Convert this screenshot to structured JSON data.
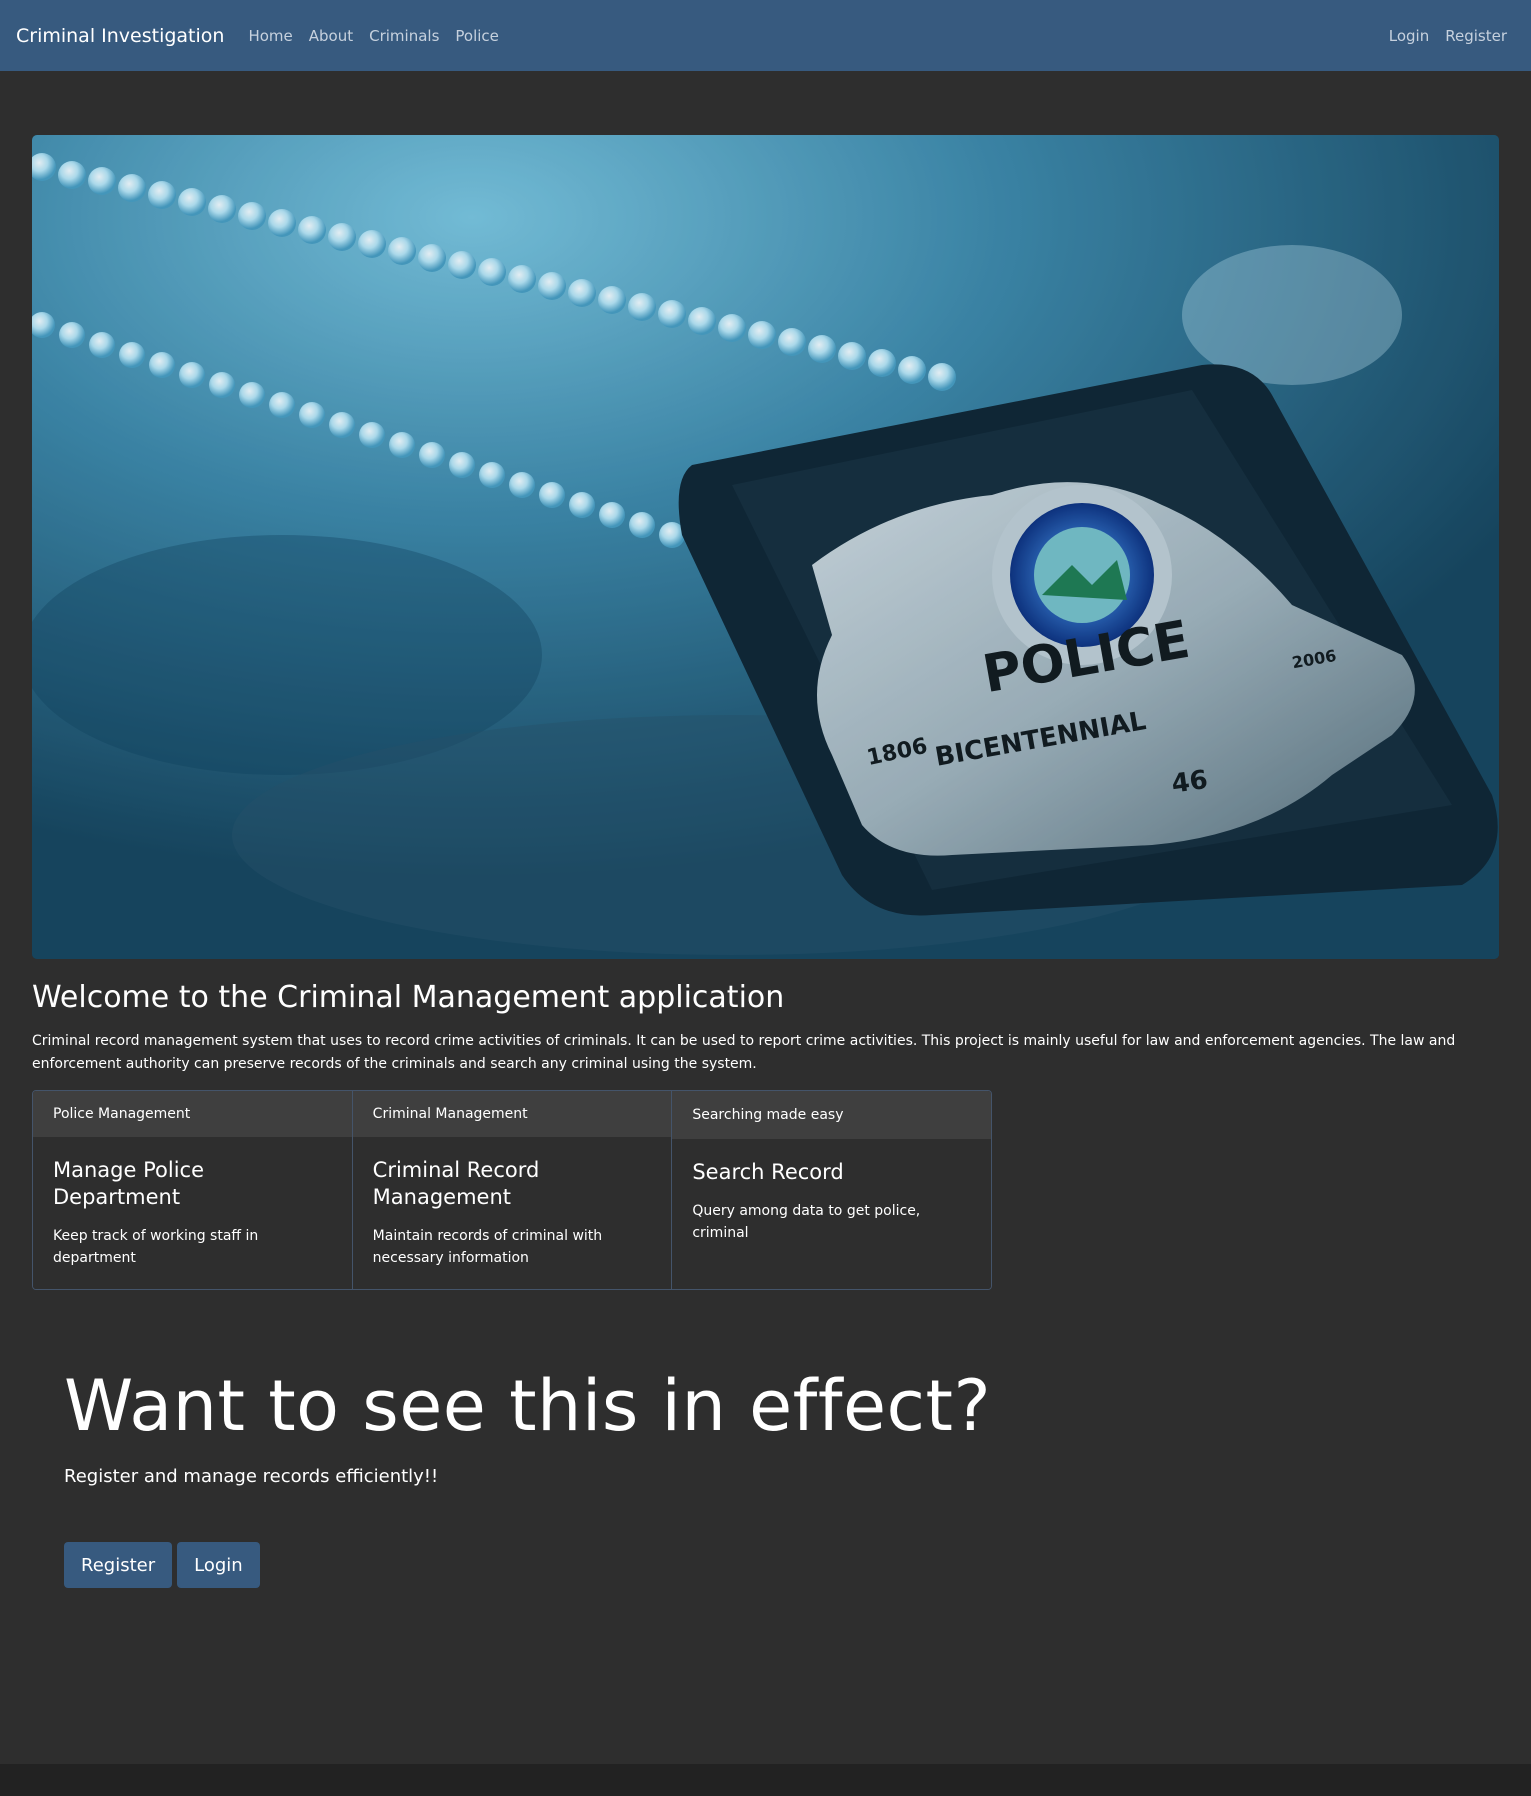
{
  "navbar": {
    "brand": "Criminal Investigation",
    "links": [
      "Home",
      "About",
      "Criminals",
      "Police"
    ],
    "auth_links": [
      "Login",
      "Register"
    ],
    "background_color": "#375a7f"
  },
  "hero": {
    "image_description_icon": "police-badge-image",
    "badge_text": {
      "main": "POLICE",
      "banner": "BICENTENNIAL",
      "year_left": "1806",
      "year_right": "2006",
      "number": "46"
    }
  },
  "welcome": {
    "title": "Welcome to the Criminal Management application",
    "text": "Criminal record management system that uses to record crime activities of criminals. It can be used to report crime activities. This project is mainly useful for law and enforcement agencies. The law and enforcement authority can preserve records of the criminals and search any criminal using the system."
  },
  "cards": [
    {
      "header": "Police Management",
      "title": "Manage Police Department",
      "text": "Keep track of working staff in department"
    },
    {
      "header": "Criminal Management",
      "title": "Criminal Record Management",
      "text": "Maintain records of criminal with necessary information"
    },
    {
      "header": "Searching made easy",
      "title": "Search Record",
      "text": "Query among data to get police, criminal"
    }
  ],
  "cta": {
    "title": "Want to see this in effect?",
    "subtitle": "Register and manage records efficiently!!",
    "register_label": "Register",
    "login_label": "Login",
    "button_color": "#375a7f"
  }
}
